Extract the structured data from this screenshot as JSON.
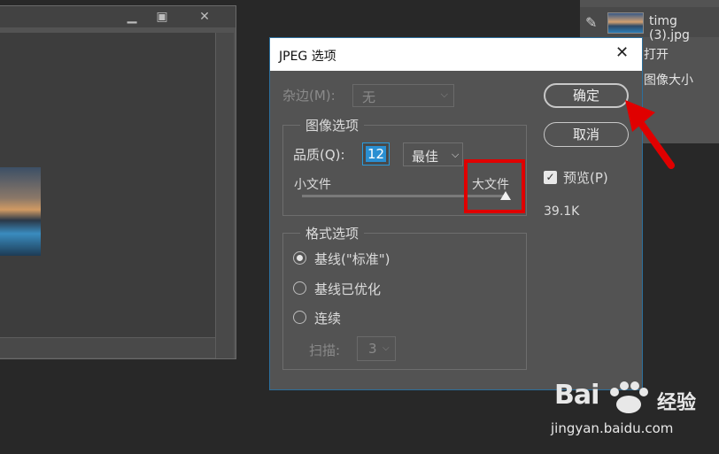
{
  "doc_window": {
    "minimize_icon": "minimize-icon",
    "maximize_icon": "maximize-icon",
    "close_glyph": "✕"
  },
  "layers_panel": {
    "layer_name": "timg (3).jpg",
    "context_menu": {
      "open": "打开",
      "image_size": "图像大小"
    }
  },
  "dialog": {
    "title": "JPEG 选项",
    "close_glyph": "✕",
    "matte": {
      "label": "杂边(M):",
      "value": "无"
    },
    "image_options": {
      "title": "图像选项",
      "quality_label": "品质(Q):",
      "quality_value": "12",
      "quality_preset": "最佳",
      "small_file_label": "小文件",
      "large_file_label": "大文件",
      "slider_level_percent": 100
    },
    "format_options": {
      "title": "格式选项",
      "baseline": "基线(\"标准\")",
      "baseline_optimized": "基线已优化",
      "progressive": "连续",
      "scans_label": "扫描:",
      "scans_value": "3",
      "selected": "baseline"
    },
    "buttons": {
      "ok": "确定",
      "cancel": "取消"
    },
    "preview": {
      "label": "预览(P)",
      "checked": true
    },
    "file_size": "39.1K"
  },
  "annotation": {
    "highlight_color": "#e00000",
    "arrow_color": "#e00000"
  },
  "watermark": {
    "brand": "Bai",
    "jingyan": "经验",
    "url": "jingyan.baidu.com"
  },
  "colors": {
    "dialog_bg": "#535353",
    "focus_blue": "#2a9bdc",
    "app_bg": "#282828"
  }
}
